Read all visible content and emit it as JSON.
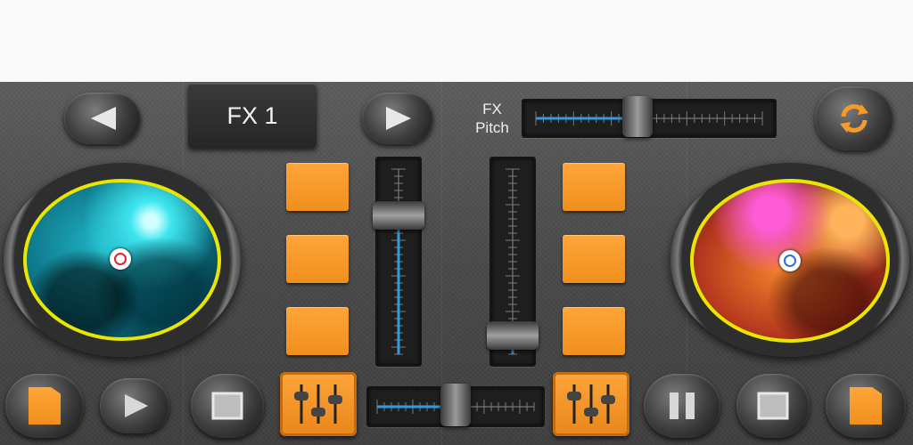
{
  "top": {
    "prev_icon": "left-triangle-icon",
    "fx_label": "FX 1",
    "next_icon": "right-triangle-icon",
    "fx_pitch_label_line1": "FX",
    "fx_pitch_label_line2": "Pitch",
    "fx_pitch_level": 0.45,
    "sync_icon": "refresh-icon"
  },
  "mixer": {
    "left_volume_level": 0.75,
    "right_volume_level": 0.1,
    "crossfader_level": 0.5
  },
  "colors": {
    "accent": "#f79a2a",
    "level_blue": "#2f9de0",
    "disc_border": "#e9e600"
  },
  "bottom": {
    "left_load_icon": "sd-card-icon",
    "left_play_icon": "play-icon",
    "left_stop_icon": "stop-icon",
    "left_eq_icon": "equalizer-icon",
    "right_eq_icon": "equalizer-icon",
    "right_pause_icon": "pause-icon",
    "right_stop_icon": "stop-icon",
    "right_load_icon": "sd-card-icon"
  }
}
